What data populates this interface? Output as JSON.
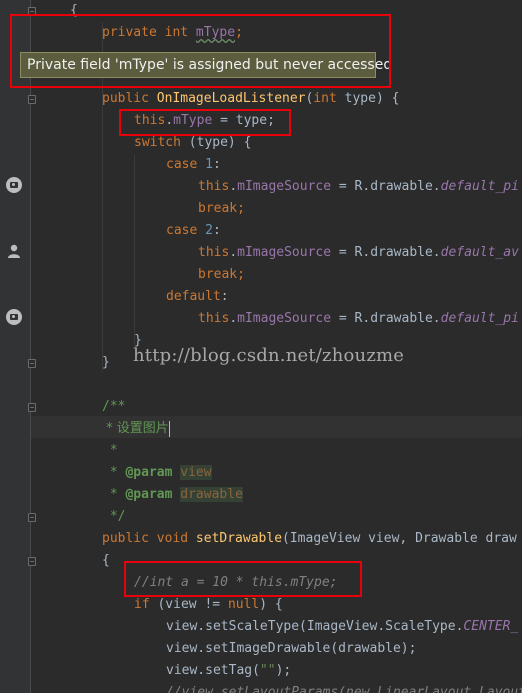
{
  "code": {
    "l1": "{",
    "l2_kw": "private int ",
    "l2_field": "mType",
    "l2_end": ";",
    "l3_kw": "public ",
    "l3_fn": "OnImageLoadListener",
    "l3_open": "(",
    "l3_kw2": "int ",
    "l3_rest": "type) {",
    "l4_this": "this",
    "l4_dot": ".",
    "l4_field": "mType",
    "l4_rest": " = type;",
    "l5_kw": "switch ",
    "l5_rest": "(type) {",
    "l6_kw": "case ",
    "l6_num": "1",
    "l6_end": ":",
    "l7_this": "this",
    "l7_dot": ".",
    "l7_field": "mImageSource",
    "l7_mid": " = R.drawable.",
    "l7_const": "default_pi",
    "l8_kw": "break",
    "l8_end": ";",
    "l9_kw": "case ",
    "l9_num": "2",
    "l9_end": ":",
    "l10_this": "this",
    "l10_dot": ".",
    "l10_field": "mImageSource",
    "l10_mid": " = R.drawable.",
    "l10_const": "default_av",
    "l11_kw": "break",
    "l11_end": ";",
    "l12_kw": "default",
    "l12_end": ":",
    "l13_this": "this",
    "l13_dot": ".",
    "l13_field": "mImageSource",
    "l13_mid": " = R.drawable.",
    "l13_const": "default_pi",
    "l14": "}",
    "l15": "}",
    "d1": "/**",
    "d2": " * 设置图片",
    "d3": " *",
    "d4_star": " * ",
    "d4_tag": "@param",
    "d4_sp": " ",
    "d4_val": "view",
    "d5_star": " * ",
    "d5_tag": "@param",
    "d5_sp": " ",
    "d5_val": "drawable",
    "d6": " */",
    "m_kw": "public void ",
    "m_fn": "setDrawable",
    "m_rest": "(ImageView view, Drawable draw",
    "m_open": "{",
    "c1": "//int a = 10 * this.mType;",
    "if_kw": "if ",
    "if_mid": "(view != ",
    "if_null": "null",
    "if_end": ") {",
    "s1_a": "view.setScaleType(ImageView.ScaleType.",
    "s1_const": "CENTER_",
    "s2": "view.setImageDrawable(drawable);",
    "s3_a": "view.setTag(",
    "s3_str": "\"\"",
    "s3_end": ");",
    "s4": "//view.setLayoutParams(new LinearLayout.Layout"
  },
  "tooltip": {
    "text": "Private field 'mType' is assigned but never accessed"
  },
  "watermark": "http://blog.csdn.net/zhouzme",
  "colors": {
    "background": "#2b2b2b",
    "gutter": "#313335",
    "keyword": "#cc7832",
    "field": "#9876aa",
    "method": "#ffc66d",
    "number": "#6897bb",
    "doc_comment": "#629755",
    "line_comment": "#808080",
    "highlight_box": "#e8000b",
    "tooltip_bg": "#5b5d3e"
  },
  "gutter_icons": [
    "camera-icon",
    "person-icon",
    "camera-icon"
  ]
}
